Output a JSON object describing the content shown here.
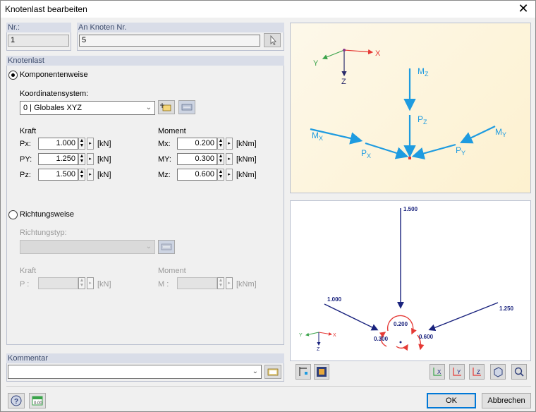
{
  "window": {
    "title": "Knotenlast bearbeiten"
  },
  "nr": {
    "label": "Nr.:",
    "value": "1"
  },
  "an_knoten": {
    "label": "An Knoten Nr.",
    "value": "5"
  },
  "knotenlast": {
    "label": "Knotenlast",
    "komponentenweise": "Komponentenweise",
    "koord_label": "Koordinatensystem:",
    "koord_value": "0 | Globales XYZ",
    "kraft_label": "Kraft",
    "moment_label": "Moment",
    "forces": [
      {
        "label": "Px:",
        "value": "1.000",
        "unit": "[kN]"
      },
      {
        "label": "PY:",
        "value": "1.250",
        "unit": "[kN]"
      },
      {
        "label": "Pz:",
        "value": "1.500",
        "unit": "[kN]"
      }
    ],
    "moments": [
      {
        "label": "Mx:",
        "value": "0.200",
        "unit": "[kNm]"
      },
      {
        "label": "MY:",
        "value": "0.300",
        "unit": "[kNm]"
      },
      {
        "label": "Mz:",
        "value": "0.600",
        "unit": "[kNm]"
      }
    ],
    "richtungsweise": "Richtungsweise",
    "richtungstyp_label": "Richtungstyp:",
    "kraft2_label": "Kraft",
    "moment2_label": "Moment",
    "p_label": "P :",
    "p_unit": "[kN]",
    "m_label": "M :",
    "m_unit": "[kNm]"
  },
  "kommentar": {
    "label": "Kommentar",
    "value": ""
  },
  "diagram_top": {
    "axis_x": "X",
    "axis_y": "Y",
    "axis_z": "Z",
    "mz": "M",
    "mz_sub": "Z",
    "pz": "P",
    "pz_sub": "Z",
    "mx": "M",
    "mx_sub": "X",
    "px": "P",
    "px_sub": "X",
    "my": "M",
    "my_sub": "Y",
    "py": "P",
    "py_sub": "Y"
  },
  "diagram_bottom": {
    "v_pz": "1.500",
    "v_px": "1.000",
    "v_py": "1.250",
    "v_mx": "0.200",
    "v_my": "0.300",
    "v_mz": "0.600",
    "axis_x": "X",
    "axis_y": "Y",
    "axis_z": "Z"
  },
  "buttons": {
    "ok": "OK",
    "cancel": "Abbrechen"
  },
  "colors": {
    "accent": "#1e9be0",
    "load_blue": "#1a237e",
    "moment_red": "#e53935"
  }
}
